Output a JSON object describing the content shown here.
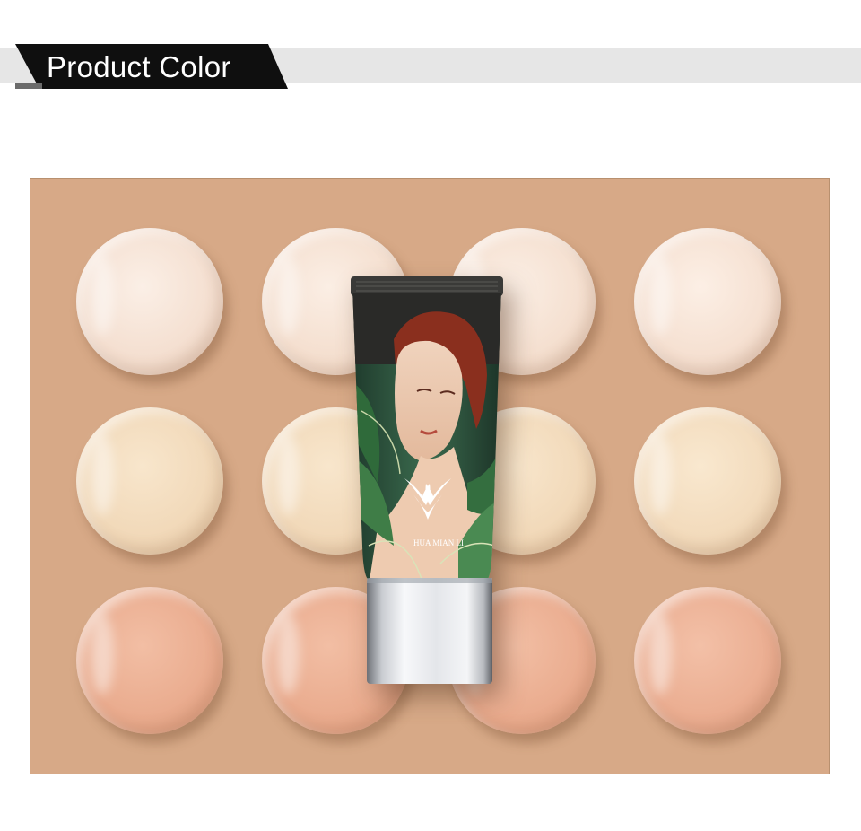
{
  "header": {
    "title": "Product Color"
  },
  "tube": {
    "brand_text": "HUA MIAN LI"
  },
  "colors": {
    "panel_background": "#d7a987",
    "row_1_shade": "#f6e3d5",
    "row_2_shade": "#f1d9b9",
    "row_3_shade": "#e6a98b",
    "banner_dark": "#0f0f0f",
    "banner_light": "#e6e6e6"
  },
  "swatches": {
    "rows": 3,
    "columns": 4,
    "shades": [
      "light ivory",
      "natural beige",
      "warm peach"
    ]
  }
}
